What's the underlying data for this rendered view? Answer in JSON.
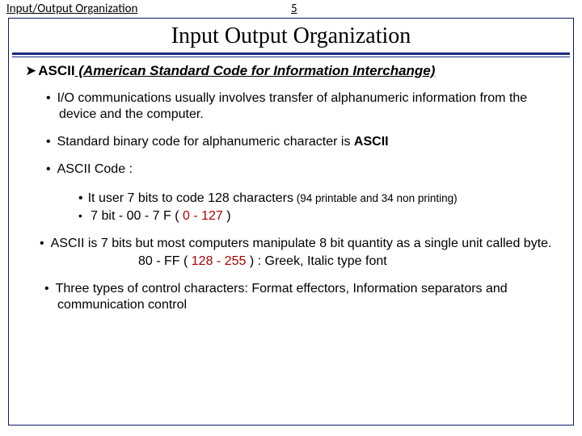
{
  "header": {
    "left": "Input/Output Organization",
    "page": "5"
  },
  "title": "Input Output Organization",
  "section": {
    "prefix": "ASCII",
    "rest": " (American Standard Code for Information Interchange)"
  },
  "bullets": {
    "b1": "I/O communications usually involves  transfer of alphanumeric information from the device and the computer.",
    "b2a": "Standard binary code for alphanumeric character is ",
    "b2b": "ASCII",
    "b3": "ASCII Code :",
    "b3s1a": "It user 7 bits to code 128 characters",
    "b3s1b": " (94 printable and 34 non printing)",
    "b3s2a": " 7 bit -       00 - 7 F ( ",
    "b3s2b": "0 - 127",
    "b3s2c": " )",
    "b4a": "ASCII is 7 bits but most computers manipulate 8 bit quantity as a single unit called byte.",
    "b4line2a": "80 - FF ( ",
    "b4line2b": "128 - 255",
    "b4line2c": " ) : Greek, Italic type font",
    "b5": "Three types of control characters: Format effectors, Information separators and communication control"
  }
}
